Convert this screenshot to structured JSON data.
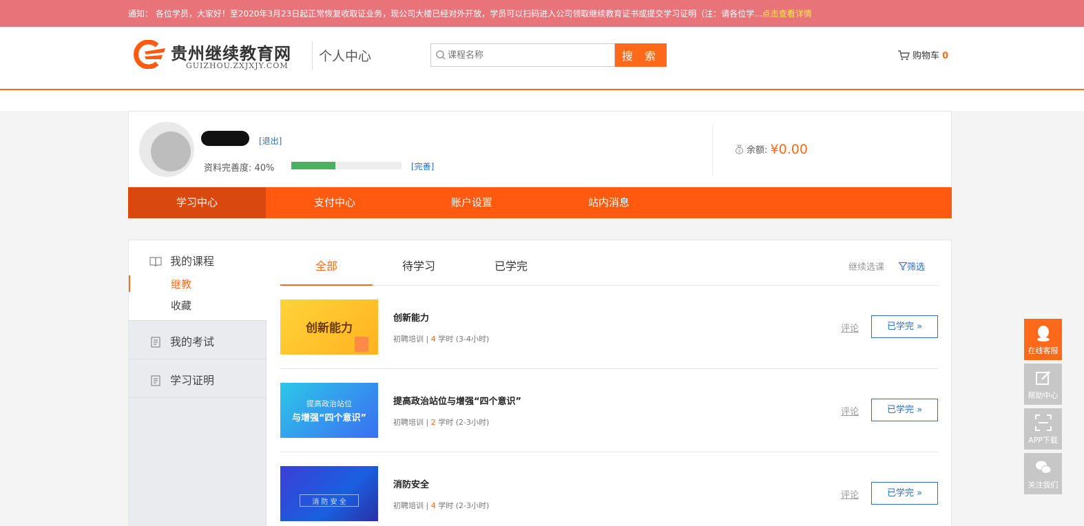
{
  "notice": {
    "prefix": "通知：",
    "text": "各位学员，大家好！至2020年3月23日起正常恢复收取证业务，现公司大楼已经对外开放，学员可以扫码进入公司领取继续教育证书或提交学习证明（注：请各位学...",
    "link": "点击查看详情"
  },
  "header": {
    "logo_title": "贵州继续教育网",
    "logo_sub": "GUIZHOU.ZXJXJY.COM",
    "section": "个人中心",
    "search_placeholder": "课程名称",
    "search_button": "搜 索",
    "cart_label": "购物车",
    "cart_count": "0"
  },
  "profile": {
    "logout": "[退出]",
    "completeness_label": "资料完善度:  40%",
    "completeness_value": 0.4,
    "complete_link": "[完善]",
    "balance_label": "余额:",
    "balance_amount": "¥0.00"
  },
  "mainnav": {
    "items": [
      "学习中心",
      "支付中心",
      "账户设置",
      "站内消息"
    ],
    "active": "学习中心"
  },
  "sidebar": {
    "courses": "我的课程",
    "sub1": "继教",
    "sub2": "收藏",
    "exams": "我的考试",
    "certificates": "学习证明"
  },
  "tabs": {
    "all": "全部",
    "pending": "待学习",
    "done": "已学完",
    "continue": "继续选课",
    "filter": "筛选"
  },
  "courses": [
    {
      "thumb_text": "创新能力",
      "title": "创新能力",
      "category": "初聘培训",
      "sep": "|",
      "hours": "4",
      "hours_unit": "学时",
      "duration": "(3-4小时)",
      "comment": "评论",
      "status": "已学完"
    },
    {
      "thumb_line1": "提高政治站位",
      "thumb_line2": "与增强“四个意识”",
      "title": "提高政治站位与增强“四个意识”",
      "category": "初聘培训",
      "sep": "|",
      "hours": "2",
      "hours_unit": "学时",
      "duration": "(2-3小时)",
      "comment": "评论",
      "status": "已学完"
    },
    {
      "thumb_text": "消 防 安 全",
      "title": "消防安全",
      "category": "初聘培训",
      "sep": "|",
      "hours": "4",
      "hours_unit": "学时",
      "duration": "(2-3小时)",
      "comment": "评论",
      "status": "已学完"
    }
  ],
  "float_tools": [
    "在线客服",
    "帮助中心",
    "APP下载",
    "关注我们"
  ],
  "colors": {
    "accent": "#ff6a1a",
    "nav": "#ff5a0f",
    "nav_active": "#d9480f",
    "link": "#2a6ec7",
    "notice_bg": "#e8747a"
  }
}
